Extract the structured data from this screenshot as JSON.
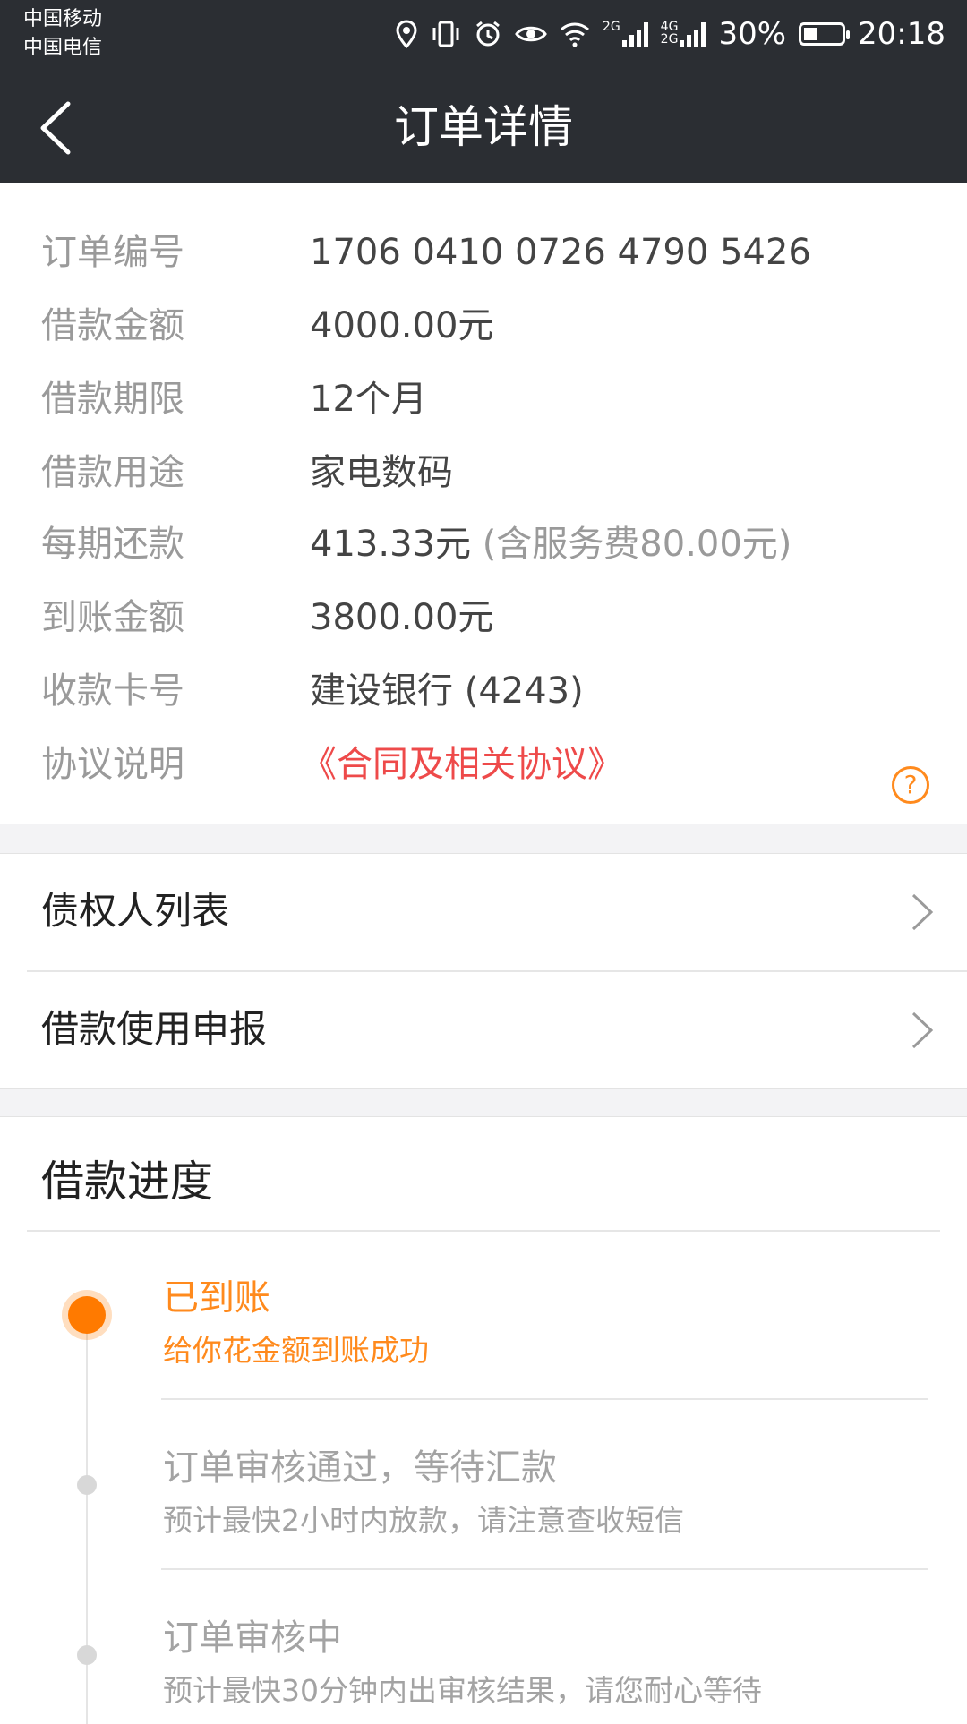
{
  "status_bar": {
    "carrier1": "中国移动",
    "carrier2": "中国电信",
    "net1": "2G",
    "net2": "4G",
    "net3": "2G",
    "battery": "30%",
    "time": "20:18"
  },
  "header": {
    "title": "订单详情"
  },
  "order": {
    "number_label": "订单编号",
    "number_value": "1706 0410 0726 4790 5426",
    "amount_label": "借款金额",
    "amount_value": "4000.00元",
    "term_label": "借款期限",
    "term_value": "12个月",
    "purpose_label": "借款用途",
    "purpose_value": "家电数码",
    "installment_label": "每期还款",
    "installment_value": "413.33元",
    "installment_note": "(含服务费80.00元)",
    "received_label": "到账金额",
    "received_value": "3800.00元",
    "card_label": "收款卡号",
    "card_value": "建设银行 (4243)",
    "agreement_label": "协议说明",
    "agreement_value": "《合同及相关协议》"
  },
  "links": {
    "creditors": "债权人列表",
    "usage_report": "借款使用申报"
  },
  "progress": {
    "title": "借款进度",
    "steps": [
      {
        "title": "已到账",
        "desc": "给你花金额到账成功"
      },
      {
        "title": "订单审核通过，等待汇款",
        "desc": "预计最快2小时内放款，请注意查收短信"
      },
      {
        "title": "订单审核中",
        "desc": "预计最快30分钟内出审核结果，请您耐心等待"
      }
    ]
  },
  "colors": {
    "header_bg": "#2b2e33",
    "accent": "#ff8a1d",
    "link_red": "#ee4a4a"
  }
}
